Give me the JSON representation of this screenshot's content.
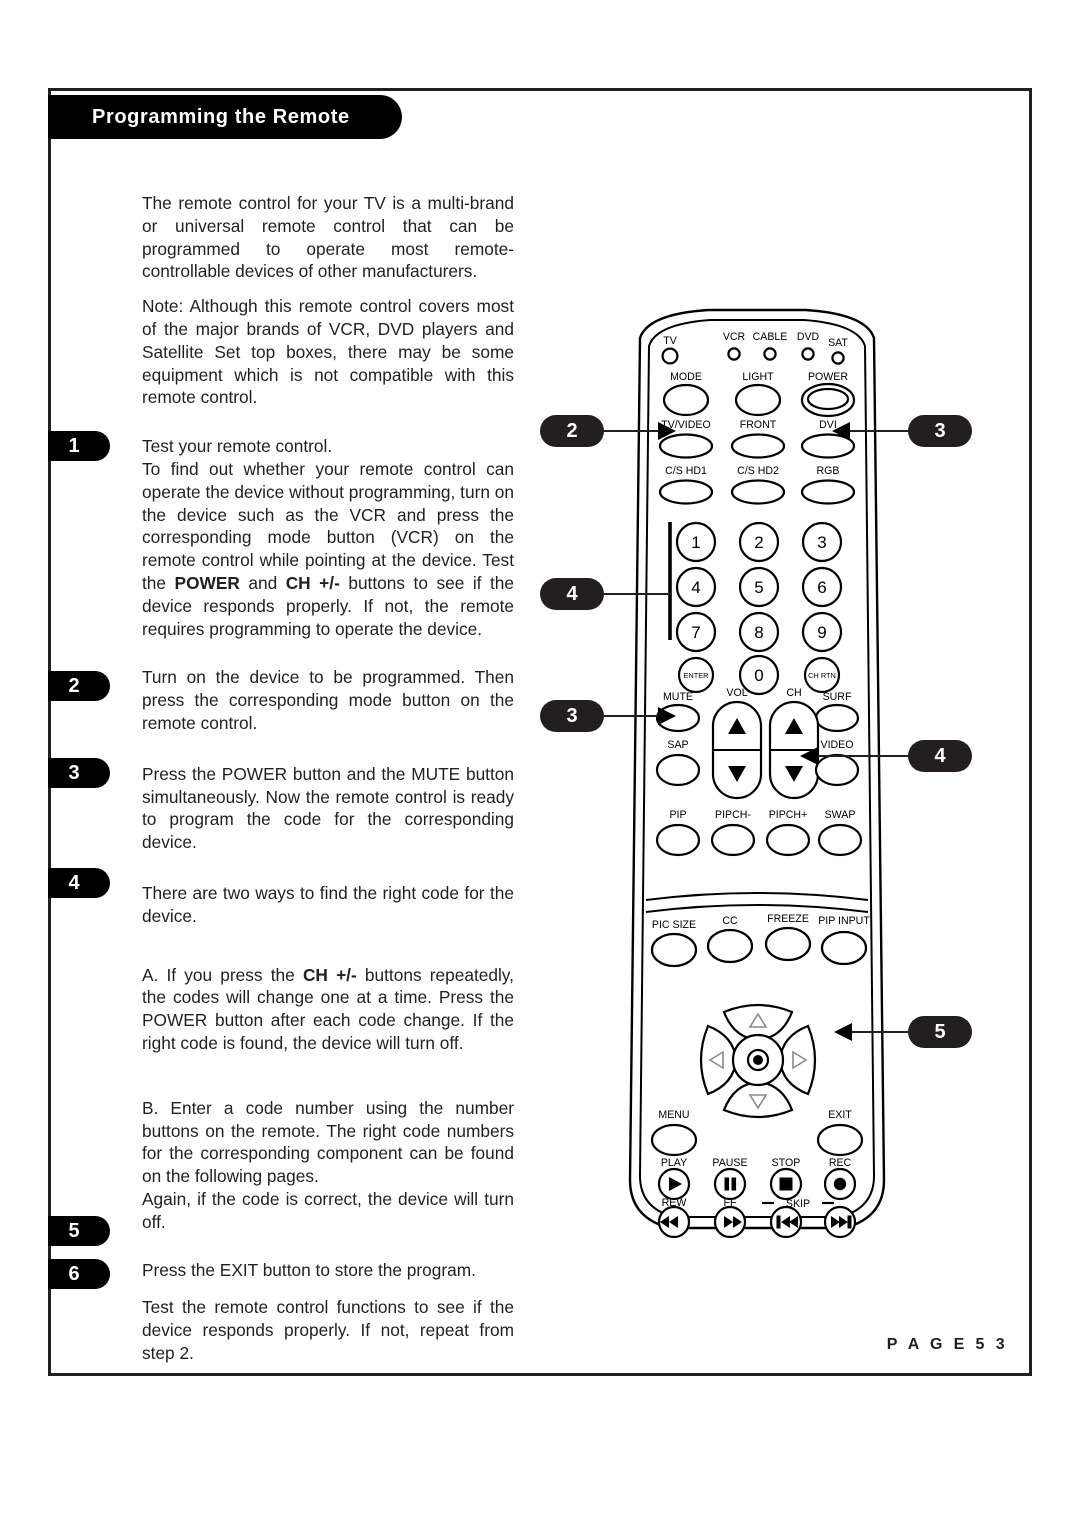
{
  "header": {
    "title": "Programming the Remote"
  },
  "footer": {
    "page_label": "P A G E  5 3"
  },
  "body": {
    "intro": "The remote control for your TV is a multi-brand or universal remote control that can be programmed to operate most remote-controllable devices of other manufacturers.",
    "note": "Note: Although this remote control covers most of the major brands of VCR, DVD players and Satellite Set top boxes, there may be some equipment which is not compatible with this remote control.",
    "step1_line1": "Test your remote control.",
    "step1_body_a": "To find out whether your remote control can operate the device without programming, turn on the device such as the VCR and press the corresponding mode button (VCR) on the remote control while pointing at the device. Test the ",
    "step1_bold_1": "POWER",
    "step1_body_b": " and ",
    "step1_bold_2": "CH +/-",
    "step1_body_c": " buttons to see if the device responds properly. If not, the remote requires programming to operate the device.",
    "step2": "Turn on the device to be programmed. Then press the corresponding mode button on the remote control.",
    "step3": "Press the POWER button and the MUTE button simultaneously. Now the remote control is ready to program the code for the corresponding device.",
    "step4": "There are two ways to find the right code for the device.",
    "optionA_a": "A. If  you press the ",
    "optionA_bold": "CH +/-",
    "optionA_b": " buttons repeatedly, the codes will change one at a time. Press the POWER button after each code change. If the right code is found, the device will turn off.",
    "optionB": "B. Enter a code number using the number buttons on the remote. The right code numbers for the corresponding component can be found on the following pages.",
    "optionB_tail": "Again, if the code is correct, the device will turn off.",
    "step5": "Press the EXIT button to store the program.",
    "step6": "Test the remote control functions to see if the device responds properly. If not, repeat from step 2."
  },
  "steps": [
    {
      "number": "1"
    },
    {
      "number": "2"
    },
    {
      "number": "3"
    },
    {
      "number": "4"
    },
    {
      "number": "5"
    },
    {
      "number": "6"
    }
  ],
  "callouts": [
    {
      "number": "2",
      "target": "mode-button"
    },
    {
      "number": "3",
      "target": "power-button"
    },
    {
      "number": "4",
      "target": "number-keypad"
    },
    {
      "number": "3",
      "target": "mute-button"
    },
    {
      "number": "4",
      "target": "ch-down-button"
    },
    {
      "number": "5",
      "target": "exit-button"
    }
  ],
  "remote": {
    "leds": [
      "TV",
      "VCR",
      "CABLE",
      "DVD",
      "SAT"
    ],
    "row_mode": [
      "MODE",
      "LIGHT",
      "POWER"
    ],
    "row_input1": [
      "TV/VIDEO",
      "FRONT",
      "DVI"
    ],
    "row_input2": [
      "C/S HD1",
      "C/S HD2",
      "RGB"
    ],
    "keypad": [
      "1",
      "2",
      "3",
      "4",
      "5",
      "6",
      "7",
      "8",
      "9",
      "ENTER",
      "0",
      "CH RTN"
    ],
    "row_mute": [
      "MUTE",
      "VOL",
      "CH",
      "SURF"
    ],
    "row_sap": [
      "SAP",
      "VIDEO"
    ],
    "row_pip": [
      "PIP",
      "PIPCH-",
      "PIPCH+",
      "SWAP"
    ],
    "row_pic": [
      "PIC SIZE",
      "CC",
      "FREEZE",
      "PIP INPUT"
    ],
    "row_menu": [
      "MENU",
      "EXIT"
    ],
    "row_transport": [
      "PLAY",
      "PAUSE",
      "STOP",
      "REC"
    ],
    "row_transport2": [
      "REW",
      "FF",
      "SKIP"
    ]
  },
  "colors": {
    "ink": "#231f20",
    "paper": "#ffffff",
    "badge": "#000000"
  }
}
